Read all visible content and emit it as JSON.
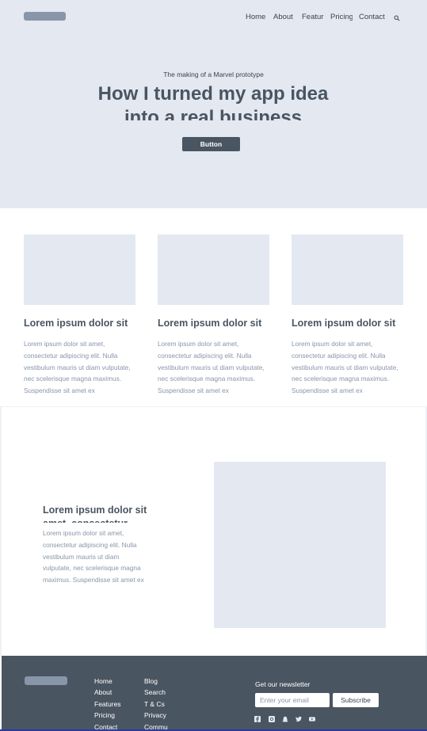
{
  "header": {
    "nav": [
      "Home",
      "About",
      "Featur",
      "Pricing",
      "Contact"
    ],
    "search_icon": "search-icon"
  },
  "hero": {
    "subtitle": "The making of a Marvel prototype",
    "title": "How I turned my app idea into a real business",
    "button_label": "Button"
  },
  "cards": [
    {
      "title": "Lorem ipsum dolor sit",
      "text": "Lorem ipsum dolor sit amet, consectetur adipiscing elit. Nulla vestibulum mauris ut diam vulputate, nec scelerisque magna maximus. Suspendisse sit amet ex"
    },
    {
      "title": "Lorem ipsum dolor sit",
      "text": "Lorem ipsum dolor sit amet, consectetur adipiscing elit. Nulla vestibulum mauris ut diam vulputate, nec scelerisque magna maximus. Suspendisse sit amet ex"
    },
    {
      "title": "Lorem ipsum dolor sit",
      "text": "Lorem ipsum dolor sit amet, consectetur adipiscing elit. Nulla vestibulum mauris ut diam vulputate, nec scelerisque magna maximus. Suspendisse sit amet ex"
    }
  ],
  "feature": {
    "title": "Lorem ipsum dolor sit amet, consectetur",
    "text": "Lorem ipsum dolor sit amet, consectetur adipiscing elit. Nulla vestibulum mauris ut diam vulputate, nec scelerisque magna maximus. Suspendisse sit amet ex"
  },
  "footer": {
    "col1": [
      "Home",
      "About",
      "Features",
      "Pricing",
      "Contact"
    ],
    "col2": [
      "Blog",
      "Search",
      "T & Cs",
      "Privacy",
      "Commu"
    ],
    "newsletter_title": "Get our newsletter",
    "email_placeholder": "Enter your email",
    "subscribe_label": "Subscribe",
    "social_icons": [
      "facebook-icon",
      "instagram-icon",
      "snapchat-icon",
      "twitter-icon",
      "youtube-icon"
    ]
  },
  "colors": {
    "hero_bg": "#e3e8f1",
    "placeholder_block": "#e3e8f1",
    "text_dark": "#4a5562",
    "text_muted": "#8896aa",
    "footer_bg": "#4a5562"
  }
}
